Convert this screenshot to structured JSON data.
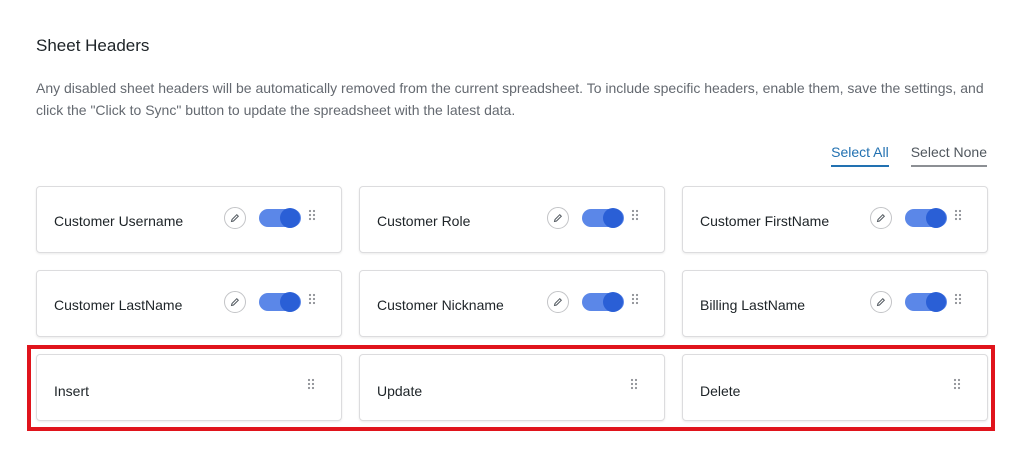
{
  "section": {
    "title": "Sheet Headers",
    "description": "Any disabled sheet headers will be automatically removed from the current spreadsheet. To include specific headers, enable them, save the settings, and click the \"Click to Sync\" button to update the spreadsheet with the latest data."
  },
  "select": {
    "all_label": "Select All",
    "none_label": "Select None"
  },
  "headers": [
    {
      "label": "Customer Username",
      "enabled": true
    },
    {
      "label": "Customer Role",
      "enabled": true
    },
    {
      "label": "Customer FirstName",
      "enabled": true
    },
    {
      "label": "Customer LastName",
      "enabled": true
    },
    {
      "label": "Customer Nickname",
      "enabled": true
    },
    {
      "label": "Billing LastName",
      "enabled": true
    }
  ],
  "actions": [
    {
      "label": "Insert"
    },
    {
      "label": "Update"
    },
    {
      "label": "Delete"
    }
  ],
  "colors": {
    "accent": "#2271b1",
    "toggle_track": "#5b87e8",
    "toggle_knob": "#2a5fd6",
    "highlight": "#e0141c"
  },
  "icons": {
    "edit": "pencil-icon",
    "drag": "drag-handle-icon"
  }
}
